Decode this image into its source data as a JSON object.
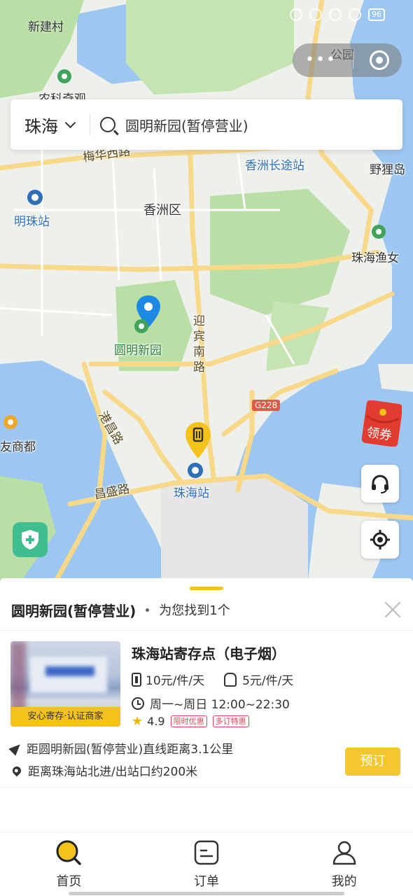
{
  "status_bar": {
    "carrier_area": "新建村",
    "battery": "96"
  },
  "map": {
    "labels": {
      "park_top": "公园",
      "nongke": "农科奇观",
      "meihua_road": "梅华西路",
      "xiangzhou_changtu": "香洲长途站",
      "yelidao": "野狸岛",
      "mingzhu_station": "明珠站",
      "xiangzhou_district": "香洲区",
      "yuren": "珠海渔女",
      "yuanming_park": "圆明新园",
      "yingbin_road": "迎宾南路",
      "g228": "G228",
      "youshangdu": "友商都",
      "gangchang_road": "港昌路",
      "changsheng_road": "昌盛路",
      "zhuhai_station": "珠海站"
    },
    "coupon_label": "领券"
  },
  "search": {
    "city": "珠海",
    "query": "圆明新园(暂停营业)"
  },
  "results": {
    "title": "圆明新园(暂停营业)",
    "count_text": "为您找到1个"
  },
  "store": {
    "name": "珠海站寄存点（电子烟）",
    "price_luggage": "10元/件/天",
    "price_bag": "5元/件/天",
    "hours": "周一~周日 12:00~22:30",
    "rating": "4.9",
    "badges": [
      "限时优惠",
      "多订特惠"
    ],
    "photo_tag": "安心寄存·认证商家",
    "distance_line": "距圆明新园(暂停营业)直线距离3.1公里",
    "exit_line": "距离珠海站北进/出站口约200米",
    "book_label": "预订"
  },
  "tabs": [
    {
      "label": "首页",
      "icon": "search-icon"
    },
    {
      "label": "订单",
      "icon": "order-icon"
    },
    {
      "label": "我的",
      "icon": "user-icon"
    }
  ],
  "colors": {
    "accent": "#f4c21b",
    "map_water": "#9dc7f0",
    "map_green": "#b9dfa6",
    "road": "#f8d98a"
  }
}
